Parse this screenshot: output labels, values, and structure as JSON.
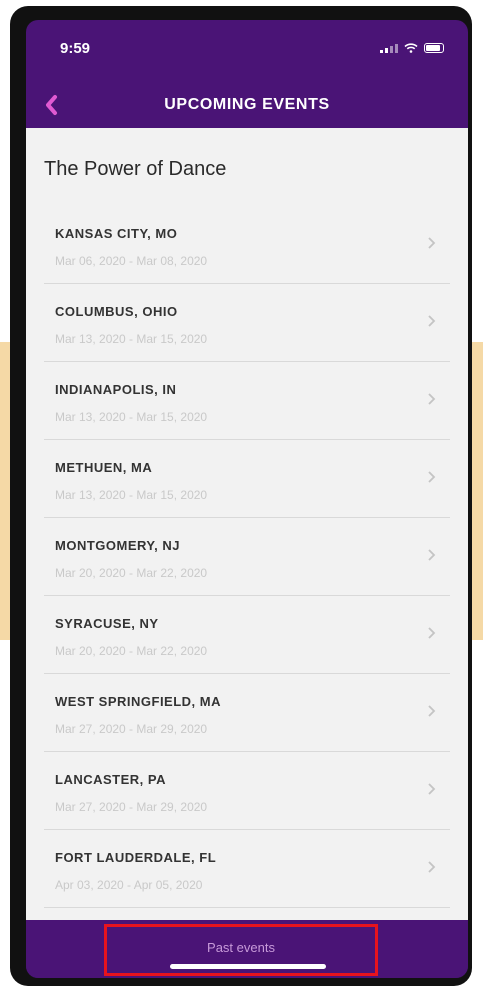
{
  "status": {
    "time": "9:59"
  },
  "nav": {
    "title": "UPCOMING EVENTS"
  },
  "page": {
    "title": "The Power of Dance"
  },
  "events": [
    {
      "city": "KANSAS CITY, MO",
      "dates": "Mar 06, 2020 - Mar 08, 2020"
    },
    {
      "city": "COLUMBUS, OHIO",
      "dates": "Mar 13, 2020 - Mar 15, 2020"
    },
    {
      "city": "INDIANAPOLIS, IN",
      "dates": "Mar 13, 2020 - Mar 15, 2020"
    },
    {
      "city": "METHUEN, MA",
      "dates": "Mar 13, 2020 - Mar 15, 2020"
    },
    {
      "city": "MONTGOMERY, NJ",
      "dates": "Mar 20, 2020 - Mar 22, 2020"
    },
    {
      "city": "SYRACUSE, NY",
      "dates": "Mar 20, 2020 - Mar 22, 2020"
    },
    {
      "city": "WEST SPRINGFIELD, MA",
      "dates": "Mar 27, 2020 - Mar 29, 2020"
    },
    {
      "city": "LANCASTER, PA",
      "dates": "Mar 27, 2020 - Mar 29, 2020"
    },
    {
      "city": "FORT LAUDERDALE, FL",
      "dates": "Apr 03, 2020 - Apr 05, 2020"
    }
  ],
  "footer": {
    "past_events_label": "Past events"
  },
  "colors": {
    "brand_purple": "#4a1476",
    "back_accent": "#e05ad2",
    "highlight_red": "#e8131d",
    "background_stripe": "#f5d9a6"
  },
  "icons": {
    "back": "chevron-left-icon",
    "row": "chevron-right-icon",
    "signal": "signal-icon",
    "wifi": "wifi-icon",
    "battery": "battery-icon"
  }
}
